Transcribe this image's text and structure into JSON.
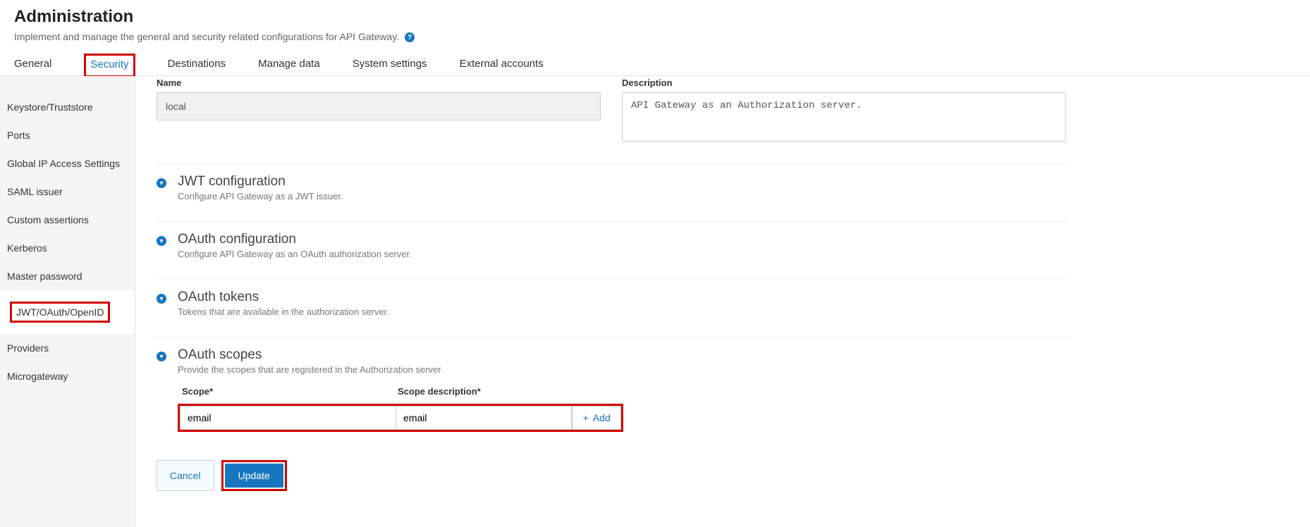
{
  "header": {
    "title": "Administration",
    "subtitle": "Implement and manage the general and security related configurations for API Gateway.",
    "help_glyph": "?"
  },
  "tabs": [
    "General",
    "Security",
    "Destinations",
    "Manage data",
    "System settings",
    "External accounts"
  ],
  "active_tab": "Security",
  "sidebar": {
    "items": [
      "Keystore/Truststore",
      "Ports",
      "Global IP Access Settings",
      "SAML issuer",
      "Custom assertions",
      "Kerberos",
      "Master password",
      "JWT/OAuth/OpenID",
      "Providers",
      "Microgateway"
    ],
    "active": "JWT/OAuth/OpenID"
  },
  "fields": {
    "name_label": "Name",
    "name_value": "local",
    "desc_label": "Description",
    "desc_value": "API Gateway as an Authorization server."
  },
  "sections": [
    {
      "title": "JWT configuration",
      "desc": "Configure API Gateway as a JWT issuer."
    },
    {
      "title": "OAuth configuration",
      "desc": "Configure API Gateway as an OAuth authorization server."
    },
    {
      "title": "OAuth tokens",
      "desc": "Tokens that are available in the authorization server."
    },
    {
      "title": "OAuth scopes",
      "desc": "Provide the scopes that are registered in the Authorization server"
    }
  ],
  "scopes": {
    "scope_label": "Scope*",
    "scope_desc_label": "Scope description*",
    "scope_value": "email",
    "scope_desc_value": "email",
    "add_label": "Add",
    "plus_glyph": "+"
  },
  "actions": {
    "cancel": "Cancel",
    "update": "Update"
  },
  "icons": {
    "expand_glyph": "▾"
  }
}
